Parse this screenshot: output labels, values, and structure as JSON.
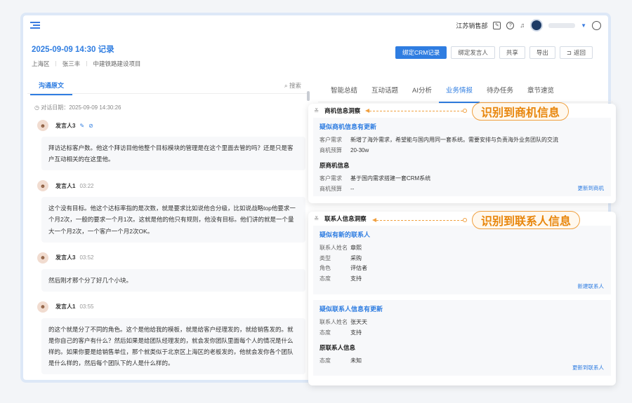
{
  "topbar": {
    "org": "江苏销售部",
    "help": "?"
  },
  "header": {
    "title": "2025-09-09 14:30 记录",
    "region": "上海区",
    "person": "张三丰",
    "project": "中建铁路建设项目"
  },
  "actions": {
    "bind_crm": "绑定CRM记录",
    "bind_speaker": "绑定发言人",
    "share": "共享",
    "export": "导出",
    "back": "返回"
  },
  "left": {
    "tab": "沟通原文",
    "search": "搜索",
    "date": "对话日期：2025-09-09 14:30:26",
    "messages": [
      {
        "speaker": "发言人3",
        "time": "",
        "text": "拜访达标客户数。他这个拜访目他他整个目标模块的管理是在这个里面去管的吗？还是只是客户互动相关的在这里他。"
      },
      {
        "speaker": "发言人1",
        "time": "03:22",
        "text": "这个没有目标。他这个达标率指的是次数，就是要求比如说他合分级，比如说战略top他要求一个月2次，一般的要求一个月1次。这就是他的他只有规则，他没有目标。他们讲的就是一个量大一个月2次，一个客户一个月2次OK。"
      },
      {
        "speaker": "发言人3",
        "time": "03:52",
        "text": "然后刚才那个分了好几个小块。"
      },
      {
        "speaker": "发言人1",
        "time": "03:55",
        "text": "的这个就是分了不同的角色。这个是他给我的模板，就是给客户经理发的，就给销售发的。就是你自己的客户有什么？然后如果是给团队经理发的，就会发你团队里面每个人的情况是什么样的。如果你要是给销售单位，那个就类似于北京区上海区的老板发的，他就会发你各个团队是什么样的，然后每个团队下的人是什么样的。"
      }
    ]
  },
  "right": {
    "tabs": [
      "智能总结",
      "互动话题",
      "AI分析",
      "业务情报",
      "待办任务",
      "章节速览"
    ],
    "active_tab": "业务情报",
    "opportunity": {
      "heading": "商机信息洞察",
      "suspected_title": "疑似商机信息有更新",
      "suspected_rows": [
        {
          "k": "客户需求",
          "v": "新增了海外需求，希望能与国内用同一套系统。需要安排与负责海外业务团队的交流"
        },
        {
          "k": "商机预算",
          "v": "20-30w"
        }
      ],
      "original_title": "原商机信息",
      "original_rows": [
        {
          "k": "客户需求",
          "v": "基于国内需求搭建一套CRM系统"
        },
        {
          "k": "商机预算",
          "v": "--"
        }
      ],
      "link": "更新到商机"
    },
    "contact": {
      "heading": "联系人信息洞察",
      "new_title": "疑似有新的联系人",
      "new_rows": [
        {
          "k": "联系人姓名",
          "v": "章熙"
        },
        {
          "k": "类型",
          "v": "采购"
        },
        {
          "k": "角色",
          "v": "评估者"
        },
        {
          "k": "态度",
          "v": "支持"
        }
      ],
      "new_link": "新建联系人",
      "update_title": "疑似联系人信息有更新",
      "update_rows": [
        {
          "k": "联系人姓名",
          "v": "张天天"
        },
        {
          "k": "态度",
          "v": "支持"
        }
      ],
      "original_title": "原联系人信息",
      "original_rows": [
        {
          "k": "态度",
          "v": "未知"
        }
      ],
      "update_link": "更新到联系人"
    }
  },
  "callouts": {
    "opportunity": "识别到商机信息",
    "contact": "识别到联系人信息"
  },
  "colors": {
    "accent": "#2f7de1",
    "callout": "#e8860c"
  }
}
